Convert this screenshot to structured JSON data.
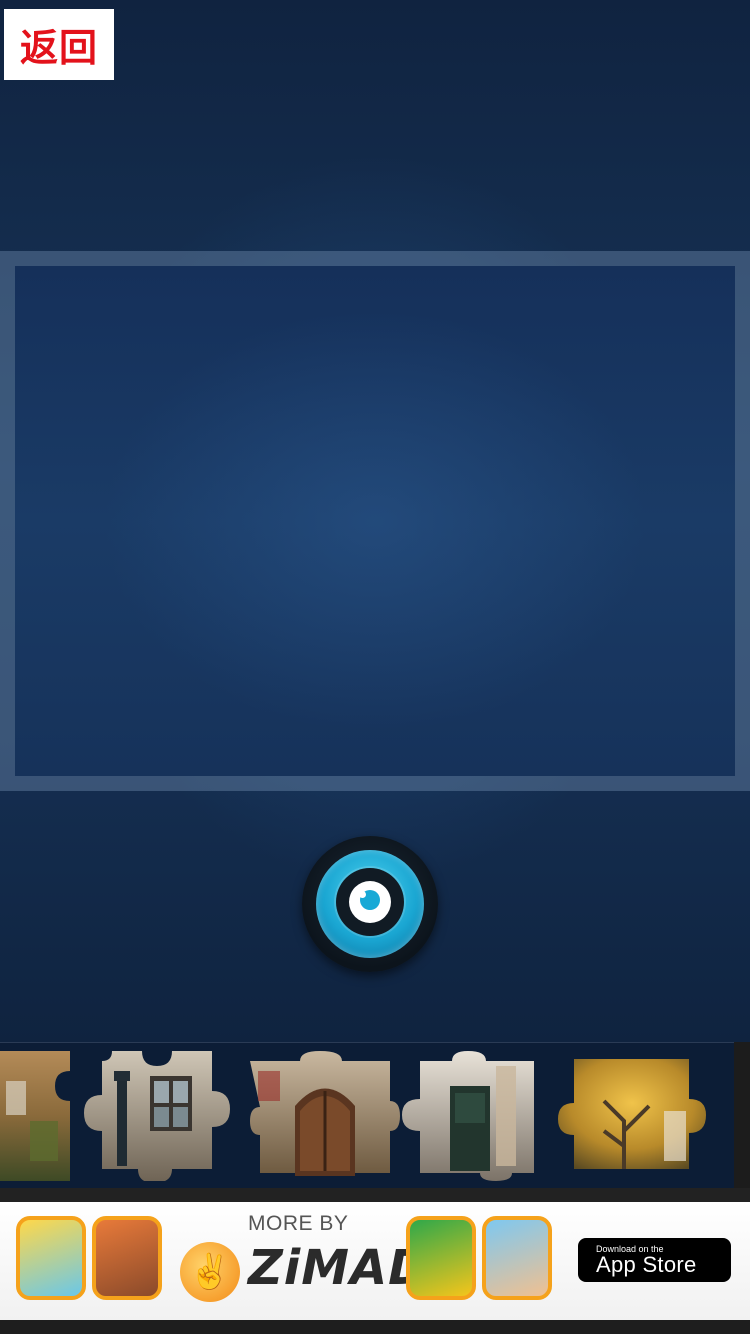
{
  "header": {
    "back_label": "返回"
  },
  "board": {
    "state": "empty"
  },
  "preview_button": {
    "icon": "eye-icon"
  },
  "tray": {
    "pieces": [
      {
        "name": "puzzle-piece-1",
        "scene": "autumn tree by building (partial)"
      },
      {
        "name": "puzzle-piece-2",
        "scene": "lamp post and windows"
      },
      {
        "name": "puzzle-piece-3",
        "scene": "arched wooden door"
      },
      {
        "name": "puzzle-piece-4",
        "scene": "dark doorway"
      },
      {
        "name": "puzzle-piece-5",
        "scene": "yellow autumn tree"
      }
    ]
  },
  "ad": {
    "more_by": "MORE BY",
    "brand": "ZiMAD",
    "appstore_small": "Download on the",
    "appstore_big": "App Store",
    "colors": {
      "tile_border": "#f5a21b",
      "brand_orange": "#f38a16"
    }
  },
  "colors": {
    "back_text": "#e3121b",
    "accent_cyan": "#1aa6d2",
    "tray_bg": "#0c1d36"
  }
}
